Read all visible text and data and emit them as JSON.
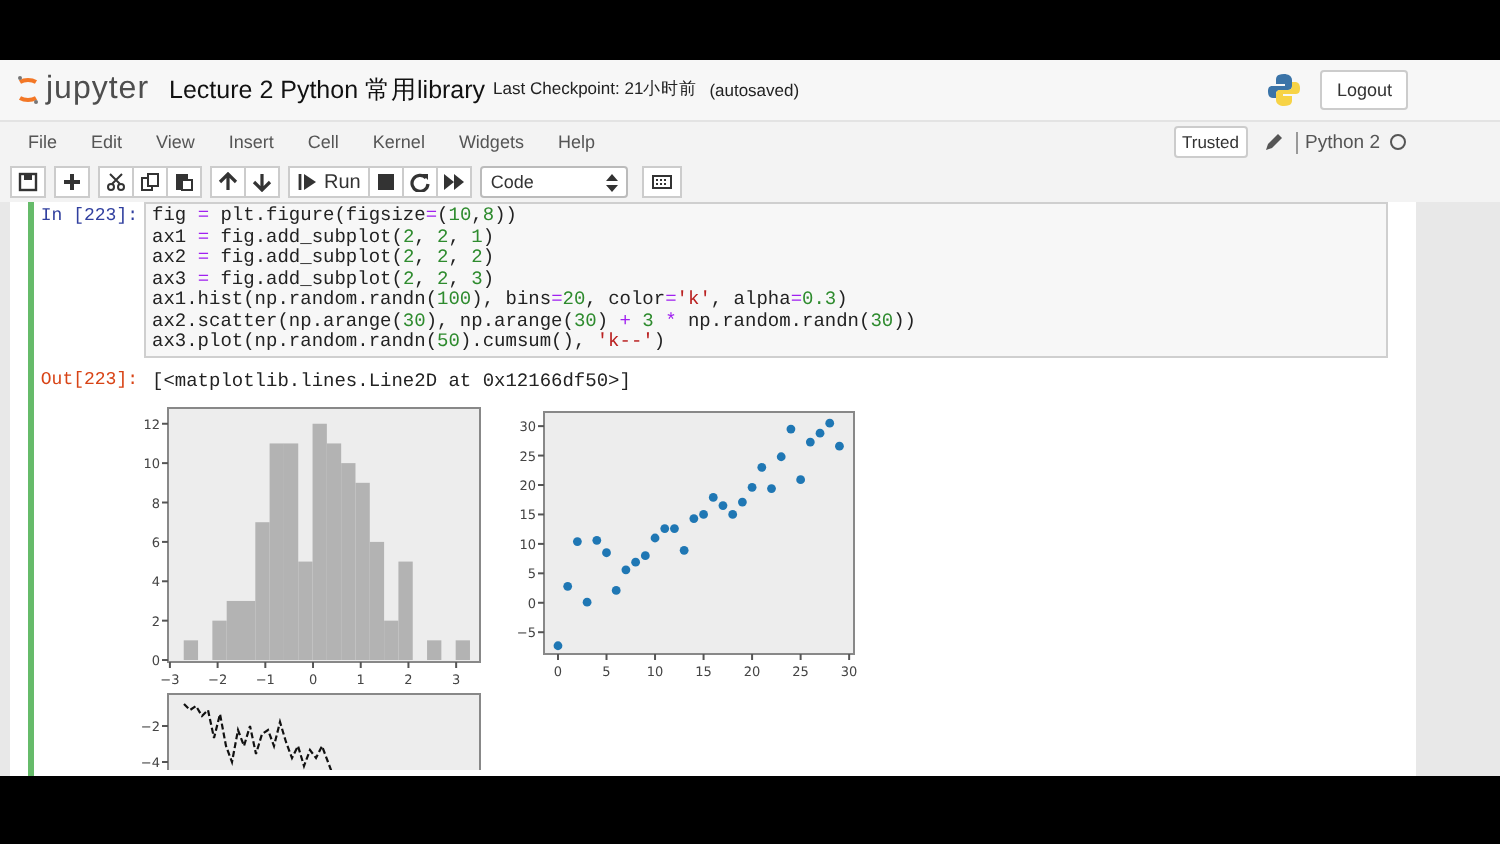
{
  "header": {
    "logo_text": "jupyter",
    "notebook_title": "Lecture 2 Python 常用library",
    "checkpoint": "Last Checkpoint: 21小时前",
    "autosave": "(autosaved)",
    "logout": "Logout"
  },
  "menu": [
    "File",
    "Edit",
    "View",
    "Insert",
    "Cell",
    "Kernel",
    "Widgets",
    "Help"
  ],
  "kernel": {
    "trusted": "Trusted",
    "name": "Python 2",
    "busy": false
  },
  "toolbar": {
    "run": "Run",
    "cell_type": "Code"
  },
  "cell": {
    "prompt_in": "In [223]:",
    "code": [
      "fig = plt.figure(figsize=(10,8))",
      "ax1 = fig.add_subplot(2, 2, 1)",
      "ax2 = fig.add_subplot(2, 2, 2)",
      "ax3 = fig.add_subplot(2, 2, 3)",
      "ax1.hist(np.random.randn(100), bins=20, color='k', alpha=0.3)",
      "ax2.scatter(np.arange(30), np.arange(30) + 3 * np.random.randn(30))",
      "ax3.plot(np.random.randn(50).cumsum(), 'k--')"
    ],
    "prompt_out": "Out[223]:",
    "output_text": "[<matplotlib.lines.Line2D at 0x12166df50>]"
  },
  "figures": [
    {
      "kind": "chart",
      "chart_data": {
        "type": "bar",
        "x": [
          -2.56,
          -2.26,
          -1.96,
          -1.66,
          -1.36,
          -1.06,
          -0.76,
          -0.46,
          -0.16,
          0.14,
          0.44,
          0.74,
          1.04,
          1.34,
          1.64,
          1.94,
          2.24,
          2.54,
          2.84,
          3.14
        ],
        "series": [
          {
            "color": "#b3b3b3",
            "values": [
              1,
              0,
              2,
              3,
              3,
              7,
              11,
              11,
              5,
              12,
              11,
              10,
              9,
              6,
              2,
              5,
              0,
              1,
              0,
              1
            ]
          }
        ],
        "xlim": [
          -3.04,
          3.5
        ],
        "ylim": [
          -0.1,
          12.8
        ],
        "xticks": [
          -3,
          -2,
          -1,
          0,
          1,
          2,
          3
        ],
        "yticks": [
          0,
          2,
          4,
          6,
          8,
          10,
          12
        ]
      }
    },
    {
      "kind": "chart",
      "chart_data": {
        "type": "scatter",
        "x": [
          0,
          1,
          2,
          3,
          4,
          5,
          6,
          7,
          8,
          9,
          10,
          11,
          12,
          13,
          14,
          15,
          16,
          17,
          18,
          19,
          20,
          21,
          22,
          23,
          24,
          25,
          26,
          27,
          28,
          29
        ],
        "series": [
          {
            "color": "#1f77b4",
            "values": [
              -7.3,
              2.8,
              10.4,
              0.1,
              10.6,
              8.5,
              2.1,
              5.6,
              6.9,
              8.0,
              11.0,
              12.6,
              12.6,
              8.9,
              14.3,
              15.0,
              17.9,
              16.5,
              15.0,
              17.1,
              19.6,
              23.0,
              19.4,
              24.8,
              29.5,
              20.9,
              27.3,
              28.8,
              30.5,
              26.6
            ]
          }
        ],
        "xlim": [
          -1.44,
          30.5
        ],
        "ylim": [
          -8.7,
          32.4
        ],
        "xticks": [
          0,
          5,
          10,
          15,
          20,
          25,
          30
        ],
        "yticks": [
          -5,
          0,
          5,
          10,
          15,
          20,
          25,
          30
        ]
      }
    },
    {
      "kind": "line_picture",
      "ytick_labels": [
        "−2",
        "−4"
      ]
    }
  ]
}
